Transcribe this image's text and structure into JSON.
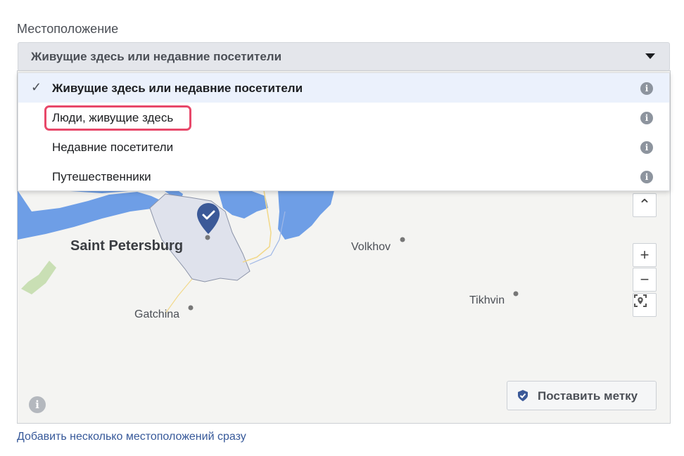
{
  "location": {
    "section_label": "Местоположение",
    "selected_value": "Живущие здесь или недавние посетители",
    "options": [
      {
        "label": "Живущие здесь или недавние посетители",
        "selected": true,
        "info_icon": "info-icon"
      },
      {
        "label": "Люди, живущие здесь",
        "selected": false,
        "highlighted": true,
        "info_icon": "info-icon"
      },
      {
        "label": "Недавние посетители",
        "selected": false,
        "info_icon": "info-icon"
      },
      {
        "label": "Путешественники",
        "selected": false,
        "info_icon": "info-icon"
      }
    ]
  },
  "map": {
    "cities": {
      "saint_petersburg": "Saint Petersburg",
      "volkhov": "Volkhov",
      "gatchina": "Gatchina",
      "tikhvin": "Tikhvin"
    },
    "controls": {
      "collapse_icon": "chevron-up-icon",
      "zoom_in_icon": "plus-icon",
      "zoom_out_icon": "minus-icon",
      "locate_icon": "location-target-icon"
    },
    "drop_pin_label": "Поставить метку",
    "info_icon": "info-icon"
  },
  "footer": {
    "add_multiple_link": "Добавить несколько местоположений сразу"
  },
  "colors": {
    "highlight": "#e8486a",
    "water": "#6e9ee6",
    "marker": "#3b5998",
    "link": "#365899",
    "selected_bg": "#ebf1fc"
  }
}
